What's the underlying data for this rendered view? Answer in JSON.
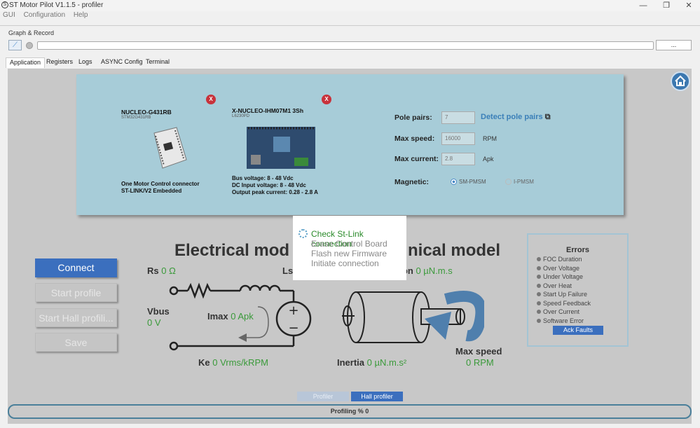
{
  "window": {
    "title": "ST Motor Pilot V1.1.5 - profiler",
    "minimize": "—",
    "maximize": "❐",
    "close": "✕"
  },
  "menu": [
    "GUI",
    "Configuration",
    "Help"
  ],
  "graph_record": {
    "label": "Graph & Record",
    "browse": "..."
  },
  "tabs": [
    "Application",
    "Registers",
    "Logs",
    "ASYNC Config",
    "Terminal"
  ],
  "boards": {
    "control": {
      "name": "NUCLEO-G431RB",
      "chip": "STM32G431RB",
      "desc1": "One Motor Control connector",
      "desc2": "ST-LINK/V2 Embedded",
      "remove": "X"
    },
    "power": {
      "name": "X-NUCLEO-IHM07M1 3Sh",
      "chip": "L6230PD",
      "desc1": "Bus voltage: 8 - 48 Vdc",
      "desc2": "DC Input voltage: 8 - 48 Vdc",
      "desc3": "Output peak current: 0.28 - 2.8 A",
      "remove": "X"
    }
  },
  "settings": {
    "pole_pairs": {
      "label": "Pole pairs:",
      "value": "7",
      "link": "Detect pole pairs"
    },
    "max_speed": {
      "label": "Max speed:",
      "value": "16000",
      "unit": "RPM"
    },
    "max_current": {
      "label": "Max current:",
      "value": "2.8",
      "unit": "Apk"
    },
    "magnetic": {
      "label": "Magnetic:",
      "opt1": "SM-PMSM",
      "opt2": "I-PMSM"
    }
  },
  "buttons": {
    "connect": "Connect",
    "start_profile": "Start profile",
    "start_hall": "Start Hall profili...",
    "save": "Save"
  },
  "electrical": {
    "title": "Electrical mod",
    "rs_label": "Rs",
    "rs_val": "0 Ω",
    "ls_label": "Ls",
    "vbus_label": "Vbus",
    "vbus_val": "0 V",
    "imax_label": "Imax",
    "imax_val": "0 Apk",
    "ke_label": "Ke",
    "ke_val": "0 Vrms/kRPM"
  },
  "mechanical": {
    "title": "nical model",
    "friction_label": "tion",
    "friction_val": "0 µN.m.s",
    "inertia_label": "Inertia",
    "inertia_val": "0 µN.m.s²",
    "maxspeed_label": "Max speed",
    "maxspeed_val": "0 RPM"
  },
  "errors": {
    "title": "Errors",
    "items": [
      "FOC Duration",
      "Over Voltage",
      "Under Voltage",
      "Over Heat",
      "Start Up Failure",
      "Speed Feedback",
      "Over Current",
      "Software Error"
    ],
    "ack": "Ack Faults"
  },
  "bottom": {
    "profiler": "Profiler",
    "hall_profiler": "Hall profiler",
    "progress": "Profiling % 0"
  },
  "popup": {
    "steps": [
      "Check St-Link connection",
      "Erase Control Board",
      "Flash new Firmware",
      "Initiate connection"
    ]
  },
  "colors": {
    "accent": "#3b6fbe",
    "panel": "#a7ccd8",
    "value_green": "#3a9a3a",
    "close_red": "#c8323b"
  }
}
